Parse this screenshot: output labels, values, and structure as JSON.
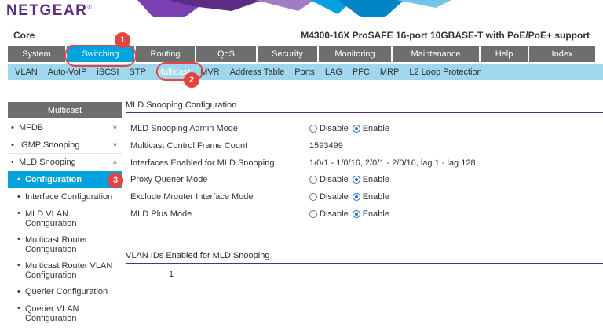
{
  "brand": {
    "logo_text": "NETGEAR",
    "reg_mark": "®"
  },
  "header": {
    "device_name": "Core",
    "model": "M4300-16X ProSAFE 16-port 10GBASE-T with PoE/PoE+ support"
  },
  "primary_nav": [
    {
      "label": "System"
    },
    {
      "label": "Switching",
      "active": true
    },
    {
      "label": "Routing"
    },
    {
      "label": "QoS"
    },
    {
      "label": "Security"
    },
    {
      "label": "Monitoring"
    },
    {
      "label": "Maintenance"
    },
    {
      "label": "Help"
    },
    {
      "label": "Index"
    }
  ],
  "secondary_nav": [
    {
      "label": "VLAN"
    },
    {
      "label": "Auto-VoIP"
    },
    {
      "label": "iSCSI"
    },
    {
      "label": "STP"
    },
    {
      "label": "Multicast",
      "active": true
    },
    {
      "label": "MVR"
    },
    {
      "label": "Address Table"
    },
    {
      "label": "Ports"
    },
    {
      "label": "LAG"
    },
    {
      "label": "PFC"
    },
    {
      "label": "MRP"
    },
    {
      "label": "L2 Loop Protection"
    }
  ],
  "sidebar": {
    "title": "Multicast",
    "groups": [
      {
        "label": "MFDB",
        "chevron": "˅"
      },
      {
        "label": "IGMP Snooping",
        "chevron": "˅"
      },
      {
        "label": "MLD Snooping",
        "chevron": "˄"
      }
    ],
    "sub_items": [
      {
        "label": "Configuration",
        "active": true
      },
      {
        "label": "Interface Configuration"
      },
      {
        "label": "MLD VLAN Configuration"
      },
      {
        "label": "Multicast Router Configuration"
      },
      {
        "label": "Multicast Router VLAN Configuration"
      },
      {
        "label": "Querier Configuration"
      },
      {
        "label": "Querier VLAN Configuration"
      }
    ]
  },
  "config": {
    "section_title": "MLD Snooping Configuration",
    "rows": [
      {
        "label": "MLD Snooping Admin Mode",
        "type": "radio",
        "options": [
          "Disable",
          "Enable"
        ],
        "selected": "Enable"
      },
      {
        "label": "Multicast Control Frame Count",
        "type": "text",
        "value": "1593499"
      },
      {
        "label": "Interfaces Enabled for MLD Snooping",
        "type": "text",
        "value": "1/0/1 - 1/0/16, 2/0/1 - 2/0/16, lag 1 - lag 128"
      },
      {
        "label": "Proxy Querier Mode",
        "type": "radio",
        "options": [
          "Disable",
          "Enable"
        ],
        "selected": "Enable"
      },
      {
        "label": "Exclude Mrouter Interface Mode",
        "type": "radio",
        "options": [
          "Disable",
          "Enable"
        ],
        "selected": "Enable"
      },
      {
        "label": "MLD Plus Mode",
        "type": "radio",
        "options": [
          "Disable",
          "Enable"
        ],
        "selected": "Enable"
      }
    ]
  },
  "vlan_section": {
    "title": "VLAN IDs Enabled for MLD Snooping",
    "ids": [
      "1"
    ]
  },
  "callouts": [
    "1",
    "2",
    "3"
  ],
  "colors": {
    "brand_purple": "#5b2d82",
    "nav_gray": "#6e6e6e",
    "active_blue": "#00a3e0",
    "subnav_bg": "#9fd8ee",
    "callout_red": "#e8423c"
  }
}
